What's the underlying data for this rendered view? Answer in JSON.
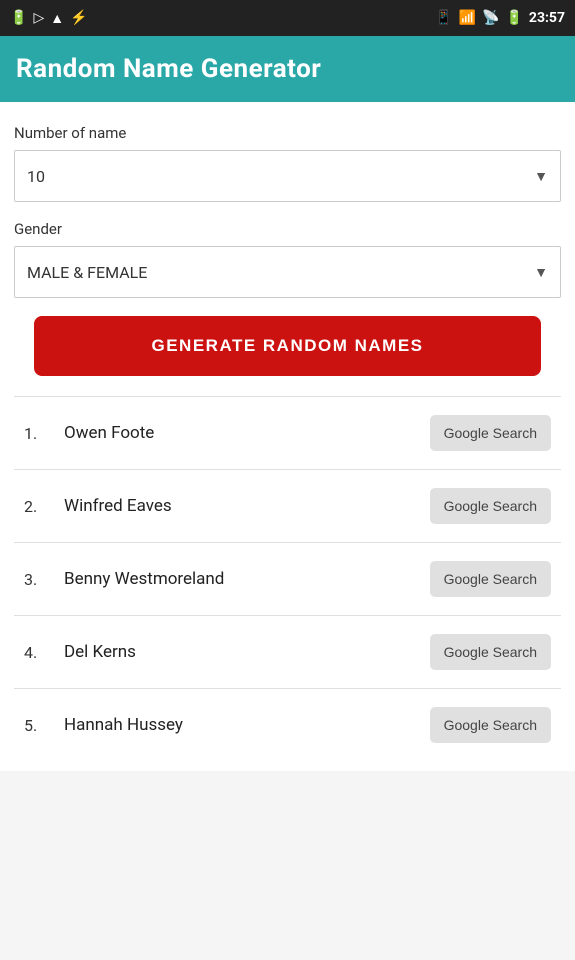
{
  "statusBar": {
    "time": "23:57",
    "icons": [
      "battery",
      "play",
      "triangle",
      "usb"
    ]
  },
  "header": {
    "title": "Random Name Generator"
  },
  "form": {
    "numberOfNameLabel": "Number of name",
    "numberOfNameValue": "10",
    "genderLabel": "Gender",
    "genderValue": "MALE & FEMALE",
    "generateButtonLabel": "GENERATE RANDOM NAMES"
  },
  "results": [
    {
      "number": "1.",
      "name": "Owen Foote",
      "searchLabel": "Google Search"
    },
    {
      "number": "2.",
      "name": "Winfred Eaves",
      "searchLabel": "Google Search"
    },
    {
      "number": "3.",
      "name": "Benny Westmoreland",
      "searchLabel": "Google Search"
    },
    {
      "number": "4.",
      "name": "Del Kerns",
      "searchLabel": "Google Search"
    },
    {
      "number": "5.",
      "name": "Hannah Hussey",
      "searchLabel": "Google Search"
    }
  ]
}
